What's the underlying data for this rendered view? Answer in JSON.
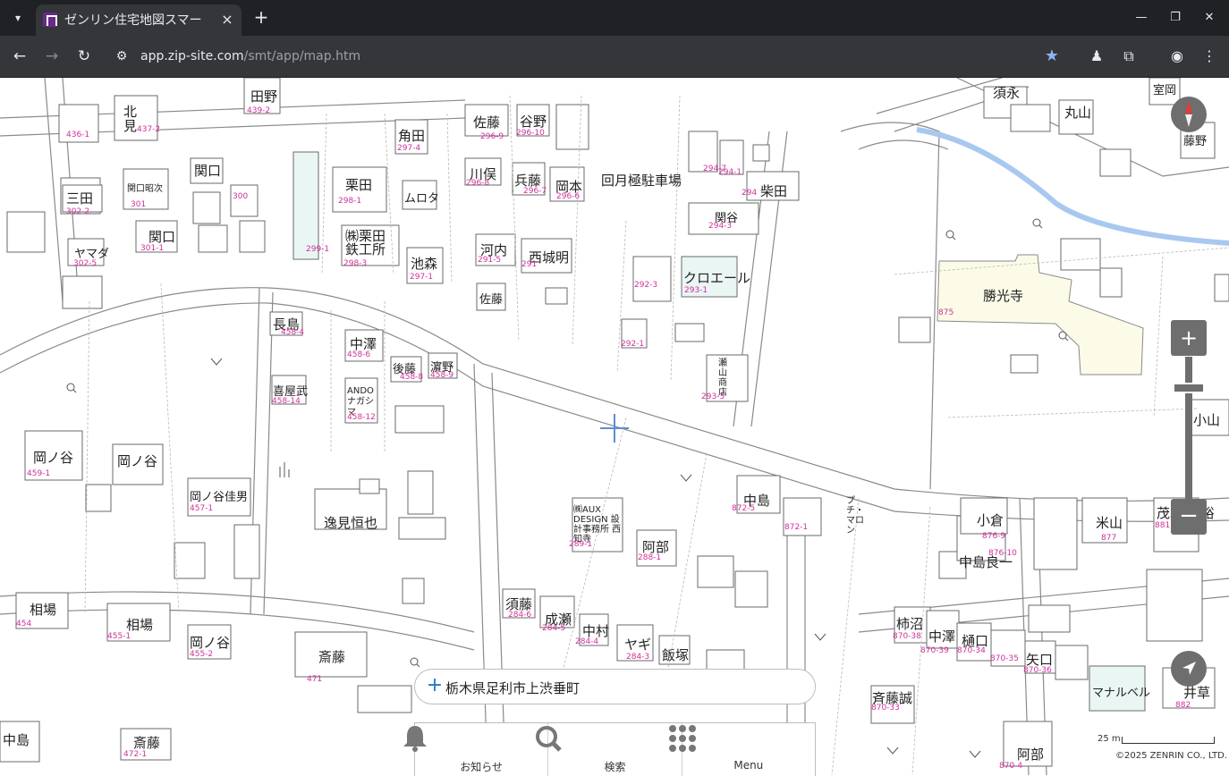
{
  "browser": {
    "tab_title": "ゼンリン住宅地図スマー",
    "url_host": "app.zip-site.com",
    "url_path": "/smt/app/map.htm"
  },
  "map": {
    "labels": {
      "tsunoda": "角田",
      "kurita": "栗田",
      "kurita_iron": "㈱栗田 鉄工所",
      "ikemori": "池森",
      "murota": "ムロタ",
      "sato": "佐藤",
      "tanino": "谷野",
      "kawamata": "川俣",
      "hyodo": "兵藤",
      "okamoto": "岡本",
      "parking": "回月極駐車場",
      "shibata": "柴田",
      "sekiya": "関谷",
      "kurowaru": "クロエール",
      "kawachi": "河内",
      "nishijo": "西城明",
      "sato2": "佐藤",
      "nagashima": "長島",
      "nakazawa": "中澤",
      "goto": "後藤",
      "hamano": "濵野",
      "kiyatake": "喜屋武",
      "ando": "ANDO ナガシマ",
      "okanoya1": "岡ノ谷",
      "okanoya2": "岡ノ谷",
      "okanoya_yoshio": "岡ノ谷佳男",
      "henmi": "逸見恒也",
      "aiba1": "相場",
      "aiba2": "相場",
      "okanoya3": "岡ノ谷",
      "saito": "斎藤",
      "saito2": "斎藤",
      "nakajima": "中島",
      "sekiguchi1": "関口",
      "sekiguchi2": "関口",
      "sekiguchi3": "関口昭次",
      "mita": "三田",
      "yamada": "ヤマダ",
      "tano": "田野",
      "kitami": "北見",
      "shokoji": "勝光寺",
      "suga": "須永",
      "maruyama": "丸山",
      "murofushi": "室岡",
      "fujino": "藤野",
      "nakajima2": "中島",
      "nakajima_ryoichi": "中島良一",
      "ogura": "小倉",
      "yoneyama": "米山",
      "moki": "茂木 好裕",
      "koyama": "小山",
      "abe": "阿部",
      "sudo": "須藤",
      "naruse": "成瀬",
      "nakamura": "中村",
      "yagi": "ヤギ",
      "iizuka": "飯塚",
      "kakinuma": "柿沼",
      "nakazawa2": "中澤",
      "higuchi": "樋口",
      "yaguchi": "矢口",
      "saito_makoto": "斉藤誠",
      "manaberu": "マナルベル",
      "ikusa": "井草",
      "abe2": "阿部",
      "petit": "プチ・マロン",
      "sekine_store": "瀬山商店",
      "nakaya_office": "㈱AUX DESIGN 設計事務所 西知寺",
      "nagaike": "長島"
    },
    "numbers": {
      "n297_4": "297-4",
      "n298_1": "298-1",
      "n298_2": "298-3",
      "n297_1": "297-1",
      "n299_1": "299-1",
      "n296_9": "296-9",
      "n296_10": "296-10",
      "n296_8": "296-8",
      "n296_7": "296-7",
      "n296_6": "296-6",
      "n294_1": "294-1",
      "n294_7": "294-7",
      "n294": "294",
      "n294_3": "294-3",
      "n293_1": "293-1",
      "n292_3": "292-3",
      "n292_1": "292-1",
      "n293_3": "293-3",
      "n291_5": "291-5",
      "n291": "291",
      "n458_4": "458-4",
      "n458_6": "458-6",
      "n458_8": "458-8",
      "n458_9": "458-9",
      "n458_14": "458-14",
      "n458_12": "458-12",
      "n459_1": "459-1",
      "n457_1": "457-1",
      "n454": "454",
      "n455_1": "455-1",
      "n455_2": "455-2",
      "n471": "471",
      "n472_1": "472-1",
      "n436_1": "436-1",
      "n437_2": "437-2",
      "n439_2": "439-2",
      "n302_2": "302-2",
      "n302_5": "302-5",
      "n301_1": "301-1",
      "n301": "301",
      "n300": "300",
      "n875": "875",
      "n872_5": "872-5",
      "n872_1": "872-1",
      "n876_9": "876-9",
      "n877": "877",
      "n881": "881",
      "n876_10": "876-10",
      "n288_1": "288-1",
      "n289_1": "289-1",
      "n284_6": "284-6",
      "n284_5": "284-5",
      "n284_4": "284-4",
      "n284_3": "284-3",
      "n870_38": "870-38",
      "n870_39": "870-39",
      "n870_34": "870-34",
      "n870_35": "870-35",
      "n870_36": "870-36",
      "n870_33": "870-33",
      "n882": "882",
      "n870_4": "870-4"
    }
  },
  "search": {
    "address": "栃木県足利市上渋垂町"
  },
  "menu": {
    "notice": "お知らせ",
    "search": "検索",
    "menu": "Menu"
  },
  "scale": {
    "label": "25 m"
  },
  "copyright": "©2025 ZENRIN CO., LTD.",
  "colors": {
    "river": "#a8c8f0",
    "temple": "#fbfbe8",
    "accent": "#2277cc",
    "parcel_number": "#d0309a"
  }
}
